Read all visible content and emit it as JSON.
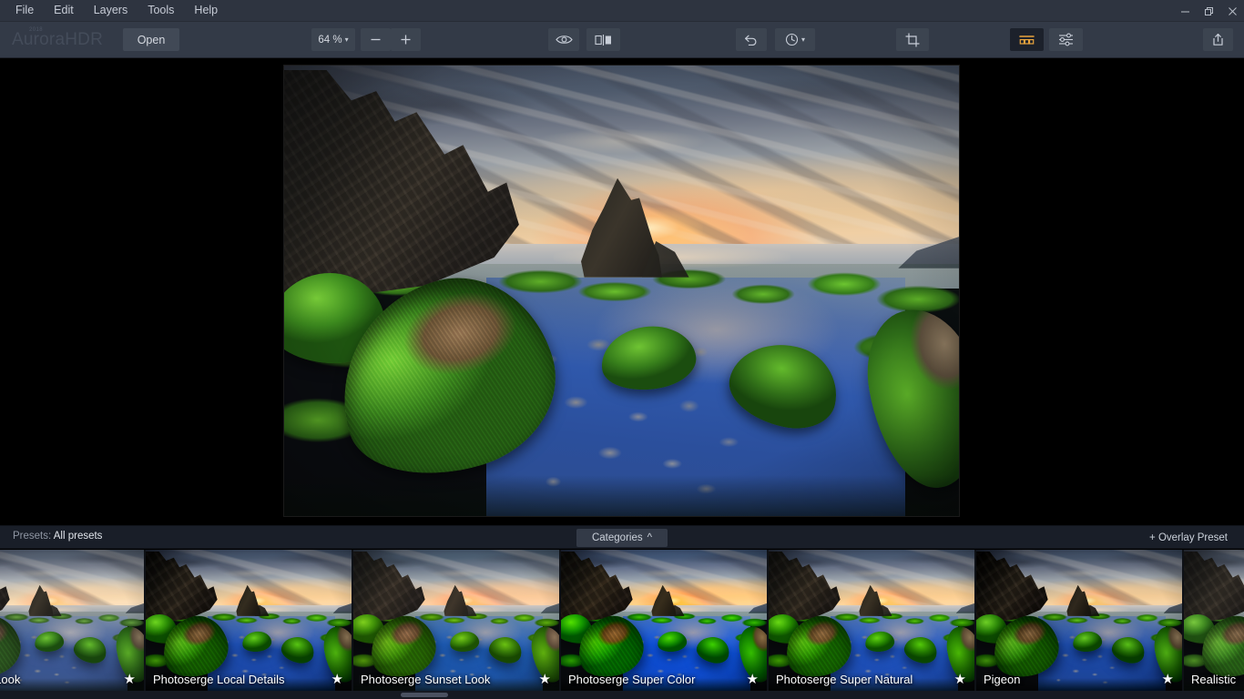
{
  "window": {
    "menus": [
      "File",
      "Edit",
      "Layers",
      "Tools",
      "Help"
    ],
    "controls": {
      "minimize": "minimize-button",
      "maximize": "restore-button",
      "close": "close-button"
    }
  },
  "toolbar": {
    "logo": "AuroraHDR",
    "logo_year": "2018",
    "open_label": "Open",
    "zoom_value": "64 %",
    "zoom_out_label": "−",
    "zoom_in_label": "+",
    "icons": {
      "preview": "eye-icon",
      "compare": "compare-split-icon",
      "undo": "undo-icon",
      "history": "history-clock-icon",
      "crop": "crop-icon",
      "presets": "presets-icon",
      "adjustments": "adjustments-sliders-icon",
      "share": "share-export-icon"
    },
    "accent_color": "#e8a33d",
    "panel_color": "#333a47"
  },
  "presets_bar": {
    "label": "Presets:",
    "value": "All presets",
    "categories_label": "Categories",
    "categories_caret": "^",
    "overlay_label": "+ Overlay Preset"
  },
  "presets": [
    {
      "name": "ollywood Look",
      "full_name": "Hollywood Look",
      "favorite": true,
      "variant": "v-hollywood"
    },
    {
      "name": "Photoserge Local Details",
      "full_name": "Photoserge Local Details",
      "favorite": true,
      "variant": "v-local"
    },
    {
      "name": "Photoserge Sunset Look",
      "full_name": "Photoserge Sunset Look",
      "favorite": true,
      "variant": "v-sunset"
    },
    {
      "name": "Photoserge Super Color",
      "full_name": "Photoserge Super Color",
      "favorite": true,
      "variant": "v-supercolor"
    },
    {
      "name": "Photoserge Super Natural",
      "full_name": "Photoserge Super Natural",
      "favorite": true,
      "variant": "v-supernatural"
    },
    {
      "name": "Pigeon",
      "full_name": "Pigeon",
      "favorite": true,
      "variant": "v-pigeon"
    },
    {
      "name": "Realistic",
      "full_name": "Realistic",
      "favorite": false,
      "variant": "v-realistic"
    }
  ],
  "star_glyph": "★",
  "canvas": {
    "photo_description": "HDR coastal sunset with moss covered boulders and tidal pool"
  }
}
